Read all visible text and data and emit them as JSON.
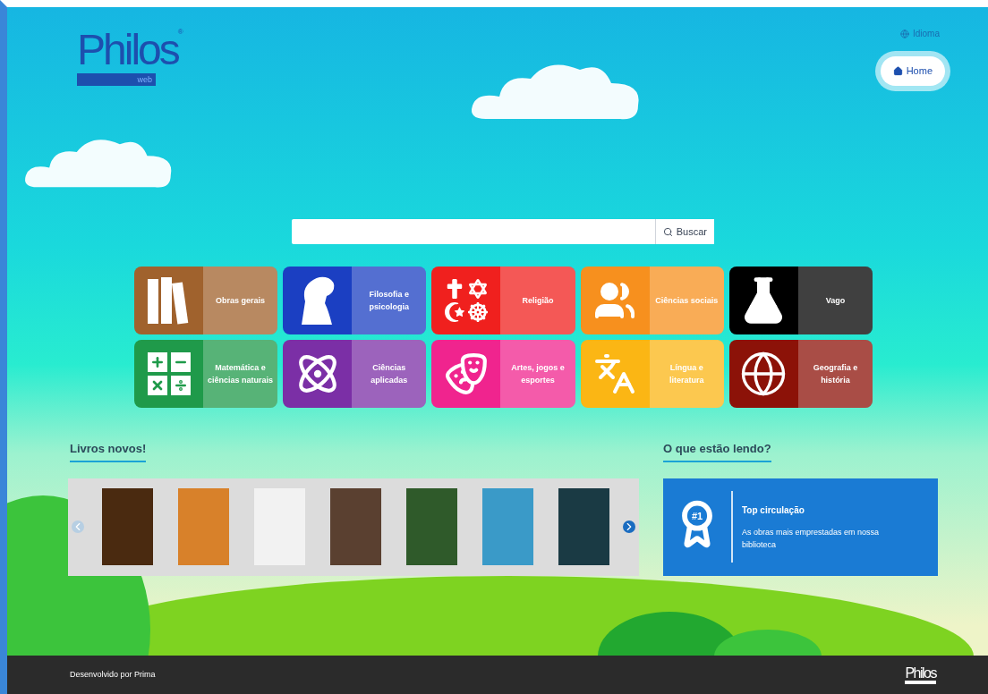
{
  "header": {
    "logo": {
      "name": "Philos",
      "mark": "®",
      "sub": "web"
    },
    "language_link": "Idioma",
    "home_button": "Home"
  },
  "search": {
    "button": "Buscar"
  },
  "categories": [
    {
      "kind": "books",
      "label": "Obras gerais",
      "color": "#a0622d"
    },
    {
      "kind": "thinker",
      "label": "Filosofia e psicologia",
      "color": "#1b3fc2"
    },
    {
      "kind": "religion",
      "label": "Religião",
      "color": "#f0201e"
    },
    {
      "kind": "people",
      "label": "Ciências sociais",
      "color": "#f7901e"
    },
    {
      "kind": "flask",
      "label": "Vago",
      "color": "#000000"
    },
    {
      "kind": "math",
      "label": "Matemática e ciências naturais",
      "color": "#1f9a4a"
    },
    {
      "kind": "atom",
      "label": "Ciências aplicadas",
      "color": "#7b2fa6"
    },
    {
      "kind": "masks",
      "label": "Artes, jogos e esportes",
      "color": "#f0248e"
    },
    {
      "kind": "languages",
      "label": "Língua e literatura",
      "color": "#fbb614"
    },
    {
      "kind": "globe",
      "label": "Geografia e história",
      "color": "#8c1208"
    }
  ],
  "new_books": {
    "title": "Livros novos!",
    "prev": {
      "disabled": true
    },
    "next": {
      "disabled": false
    }
  },
  "reading": {
    "title": "O que estão lendo?",
    "badge": "#1",
    "card_title": "Top circulação",
    "card_text": "As obras mais emprestadas em nossa biblioteca"
  },
  "footer": {
    "credit": "Desenvolvido por Prima",
    "logo": "Philos"
  }
}
